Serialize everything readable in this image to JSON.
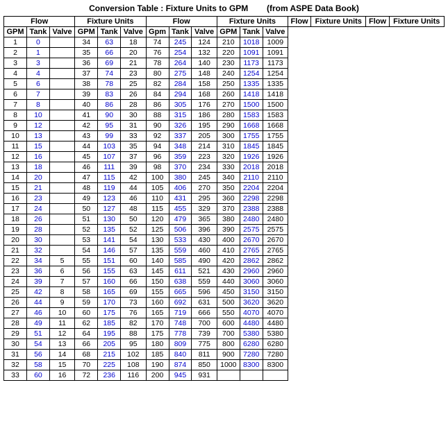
{
  "title": "Conversion Table : Fixture Units to GPM",
  "subtitle": "(from ASPE Data Book)",
  "headers": {
    "row1": [
      "Flow",
      "Fixture Units",
      "Flow",
      "Fixture Units",
      "Flow",
      "Fixture Units",
      "Flow",
      "Fixture Units"
    ],
    "row2": [
      "GPM",
      "Tank",
      "Valve",
      "GPM",
      "Tank",
      "Valve",
      "Gpm",
      "Tank",
      "Valve",
      "GPM",
      "Tank",
      "Valve"
    ]
  },
  "rows": [
    [
      1,
      "0",
      "",
      "",
      "34",
      "63",
      "18",
      "74",
      "245",
      "124",
      "210",
      "1018",
      "1009"
    ],
    [
      2,
      "1",
      "",
      "",
      "35",
      "66",
      "20",
      "76",
      "254",
      "132",
      "220",
      "1091",
      "1091"
    ],
    [
      3,
      "3",
      "",
      "",
      "36",
      "69",
      "21",
      "78",
      "264",
      "140",
      "230",
      "1173",
      "1173"
    ],
    [
      4,
      "4",
      "",
      "",
      "37",
      "74",
      "23",
      "80",
      "275",
      "148",
      "240",
      "1254",
      "1254"
    ],
    [
      5,
      "6",
      "",
      "",
      "38",
      "78",
      "25",
      "82",
      "284",
      "158",
      "250",
      "1335",
      "1335"
    ],
    [
      6,
      "7",
      "",
      "",
      "39",
      "83",
      "26",
      "84",
      "294",
      "168",
      "260",
      "1418",
      "1418"
    ],
    [
      7,
      "8",
      "",
      "",
      "40",
      "86",
      "28",
      "86",
      "305",
      "176",
      "270",
      "1500",
      "1500"
    ],
    [
      8,
      "10",
      "",
      "",
      "41",
      "90",
      "30",
      "88",
      "315",
      "186",
      "280",
      "1583",
      "1583"
    ],
    [
      9,
      "12",
      "",
      "",
      "42",
      "95",
      "31",
      "90",
      "326",
      "195",
      "290",
      "1668",
      "1668"
    ],
    [
      10,
      "13",
      "",
      "",
      "43",
      "99",
      "33",
      "92",
      "337",
      "205",
      "300",
      "1755",
      "1755"
    ],
    [
      11,
      "15",
      "",
      "",
      "44",
      "103",
      "35",
      "94",
      "348",
      "214",
      "310",
      "1845",
      "1845"
    ],
    [
      12,
      "16",
      "",
      "",
      "45",
      "107",
      "37",
      "96",
      "359",
      "223",
      "320",
      "1926",
      "1926"
    ],
    [
      13,
      "18",
      "",
      "",
      "46",
      "111",
      "39",
      "98",
      "370",
      "234",
      "330",
      "2018",
      "2018"
    ],
    [
      14,
      "20",
      "",
      "",
      "47",
      "115",
      "42",
      "100",
      "380",
      "245",
      "340",
      "2110",
      "2110"
    ],
    [
      15,
      "21",
      "",
      "",
      "48",
      "119",
      "44",
      "105",
      "406",
      "270",
      "350",
      "2204",
      "2204"
    ],
    [
      16,
      "23",
      "",
      "",
      "49",
      "123",
      "46",
      "110",
      "431",
      "295",
      "360",
      "2298",
      "2298"
    ],
    [
      17,
      "24",
      "",
      "",
      "50",
      "127",
      "48",
      "115",
      "455",
      "329",
      "370",
      "2388",
      "2388"
    ],
    [
      18,
      "26",
      "",
      "",
      "51",
      "130",
      "50",
      "120",
      "479",
      "365",
      "380",
      "2480",
      "2480"
    ],
    [
      19,
      "28",
      "",
      "",
      "52",
      "135",
      "52",
      "125",
      "506",
      "396",
      "390",
      "2575",
      "2575"
    ],
    [
      20,
      "30",
      "",
      "",
      "53",
      "141",
      "54",
      "130",
      "533",
      "430",
      "400",
      "2670",
      "2670"
    ],
    [
      21,
      "32",
      "",
      "",
      "54",
      "146",
      "57",
      "135",
      "559",
      "460",
      "410",
      "2765",
      "2765"
    ],
    [
      22,
      "34",
      "5",
      "",
      "55",
      "151",
      "60",
      "140",
      "585",
      "490",
      "420",
      "2862",
      "2862"
    ],
    [
      23,
      "36",
      "6",
      "",
      "56",
      "155",
      "63",
      "145",
      "611",
      "521",
      "430",
      "2960",
      "2960"
    ],
    [
      24,
      "39",
      "7",
      "",
      "57",
      "160",
      "66",
      "150",
      "638",
      "559",
      "440",
      "3060",
      "3060"
    ],
    [
      25,
      "42",
      "8",
      "",
      "58",
      "165",
      "69",
      "155",
      "665",
      "596",
      "450",
      "3150",
      "3150"
    ],
    [
      26,
      "44",
      "9",
      "",
      "59",
      "170",
      "73",
      "160",
      "692",
      "631",
      "500",
      "3620",
      "3620"
    ],
    [
      27,
      "46",
      "10",
      "",
      "60",
      "175",
      "76",
      "165",
      "719",
      "666",
      "550",
      "4070",
      "4070"
    ],
    [
      28,
      "49",
      "11",
      "",
      "62",
      "185",
      "82",
      "170",
      "748",
      "700",
      "600",
      "4480",
      "4480"
    ],
    [
      29,
      "51",
      "12",
      "",
      "64",
      "195",
      "88",
      "175",
      "778",
      "739",
      "700",
      "5380",
      "5380"
    ],
    [
      30,
      "54",
      "13",
      "",
      "66",
      "205",
      "95",
      "180",
      "809",
      "775",
      "800",
      "6280",
      "6280"
    ],
    [
      31,
      "56",
      "14",
      "",
      "68",
      "215",
      "102",
      "185",
      "840",
      "811",
      "900",
      "7280",
      "7280"
    ],
    [
      32,
      "58",
      "15",
      "",
      "70",
      "225",
      "108",
      "190",
      "874",
      "850",
      "1000",
      "8300",
      "8300"
    ],
    [
      33,
      "60",
      "16",
      "",
      "72",
      "236",
      "116",
      "200",
      "945",
      "931",
      "",
      "",
      ""
    ]
  ]
}
